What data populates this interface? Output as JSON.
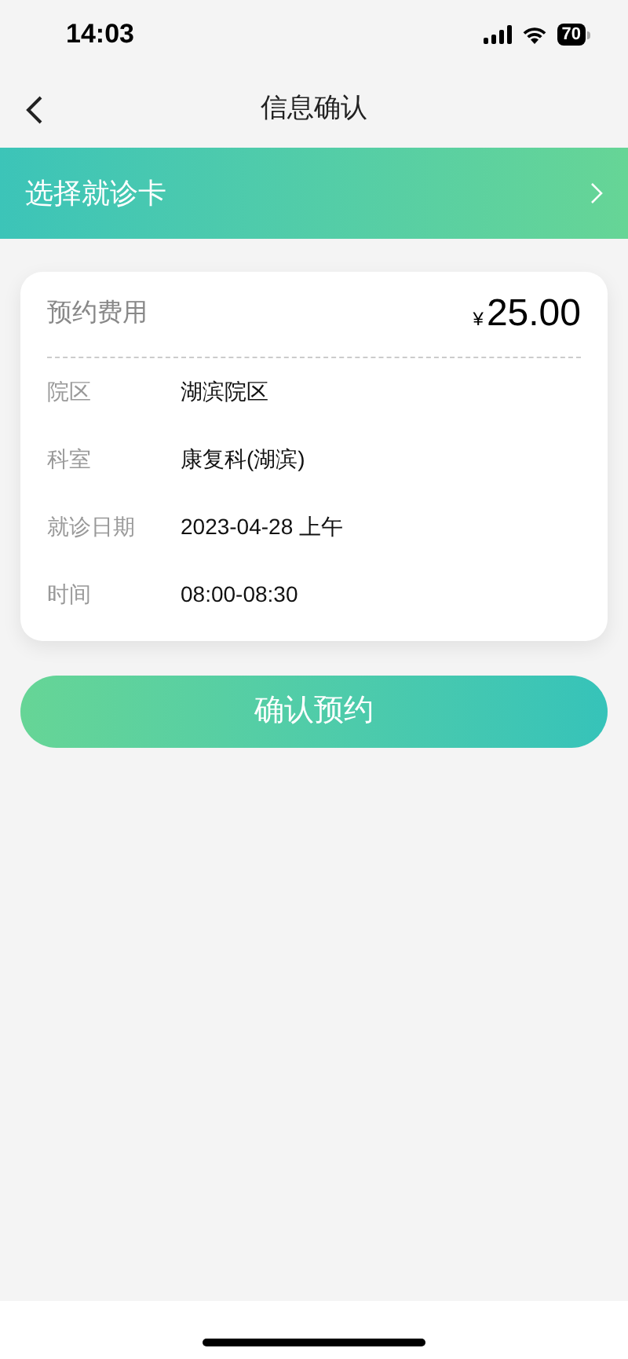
{
  "status_bar": {
    "time": "14:03",
    "battery": "70"
  },
  "nav": {
    "title": "信息确认"
  },
  "card_picker": {
    "label": "选择就诊卡"
  },
  "summary": {
    "fee_label": "预约费用",
    "currency": "¥",
    "fee": "25.00",
    "rows": [
      {
        "label": "院区",
        "value": "湖滨院区"
      },
      {
        "label": "科室",
        "value": "康复科(湖滨)"
      },
      {
        "label": "就诊日期",
        "value": "2023-04-28 上午"
      },
      {
        "label": "时间",
        "value": "08:00-08:30"
      }
    ]
  },
  "confirm_button": {
    "label": "确认预约"
  }
}
